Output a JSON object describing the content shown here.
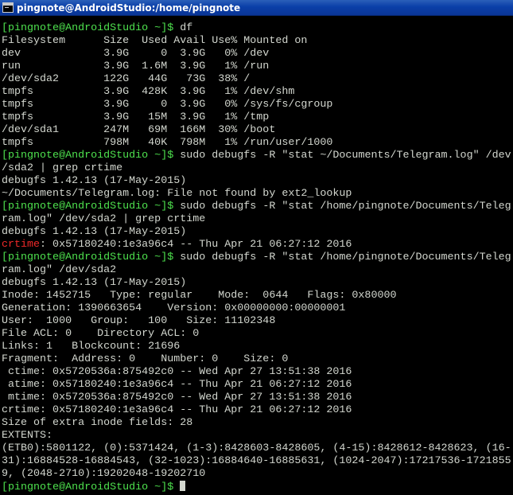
{
  "window": {
    "title": "pingnote@AndroidStudio:/home/pingnote",
    "app_icon": "terminal-icon"
  },
  "colors": {
    "titlebar": "#0a3fa8",
    "background": "#000000",
    "foreground": "#d3d7cf",
    "prompt": "#4ee24e",
    "highlight": "#ef2929"
  },
  "terminal": {
    "prompt": "[pingnote@AndroidStudio ~]$",
    "lines": [
      {
        "prompt": "[pingnote@AndroidStudio ~]$",
        "text": " df"
      },
      {
        "text": "Filesystem      Size  Used Avail Use% Mounted on"
      },
      {
        "text": "dev             3.9G     0  3.9G   0% /dev"
      },
      {
        "text": "run             3.9G  1.6M  3.9G   1% /run"
      },
      {
        "text": "/dev/sda2       122G   44G   73G  38% /"
      },
      {
        "text": "tmpfs           3.9G  428K  3.9G   1% /dev/shm"
      },
      {
        "text": "tmpfs           3.9G     0  3.9G   0% /sys/fs/cgroup"
      },
      {
        "text": "tmpfs           3.9G   15M  3.9G   1% /tmp"
      },
      {
        "text": "/dev/sda1       247M   69M  166M  30% /boot"
      },
      {
        "text": "tmpfs           798M   40K  798M   1% /run/user/1000"
      },
      {
        "prompt": "[pingnote@AndroidStudio ~]$",
        "text": " sudo debugfs -R \"stat ~/Documents/Telegram.log\" /dev"
      },
      {
        "text": "/sda2 | grep crtime"
      },
      {
        "text": "debugfs 1.42.13 (17-May-2015)"
      },
      {
        "text": "~/Documents/Telegram.log: File not found by ext2_lookup"
      },
      {
        "prompt": "[pingnote@AndroidStudio ~]$",
        "text": " sudo debugfs -R \"stat /home/pingnote/Documents/Teleg"
      },
      {
        "text": "ram.log\" /dev/sda2 | grep crtime"
      },
      {
        "text": "debugfs 1.42.13 (17-May-2015)"
      },
      {
        "red": "crtime",
        "text": ": 0x57180240:1e3a96c4 -- Thu Apr 21 06:27:12 2016"
      },
      {
        "prompt": "[pingnote@AndroidStudio ~]$",
        "text": " sudo debugfs -R \"stat /home/pingnote/Documents/Teleg"
      },
      {
        "text": "ram.log\" /dev/sda2"
      },
      {
        "text": "debugfs 1.42.13 (17-May-2015)"
      },
      {
        "text": "Inode: 1452715   Type: regular    Mode:  0644   Flags: 0x80000"
      },
      {
        "text": "Generation: 1390663654    Version: 0x00000000:00000001"
      },
      {
        "text": "User:  1000   Group:   100   Size: 11102348"
      },
      {
        "text": "File ACL: 0    Directory ACL: 0"
      },
      {
        "text": "Links: 1   Blockcount: 21696"
      },
      {
        "text": "Fragment:  Address: 0    Number: 0    Size: 0"
      },
      {
        "text": " ctime: 0x5720536a:875492c0 -- Wed Apr 27 13:51:38 2016"
      },
      {
        "text": " atime: 0x57180240:1e3a96c4 -- Thu Apr 21 06:27:12 2016"
      },
      {
        "text": " mtime: 0x5720536a:875492c0 -- Wed Apr 27 13:51:38 2016"
      },
      {
        "text": "crtime: 0x57180240:1e3a96c4 -- Thu Apr 21 06:27:12 2016"
      },
      {
        "text": "Size of extra inode fields: 28"
      },
      {
        "text": "EXTENTS:"
      },
      {
        "text": "(ETB0):5801122, (0):5371424, (1-3):8428603-8428605, (4-15):8428612-8428623, (16-"
      },
      {
        "text": "31):16884528-16884543, (32-1023):16884640-16885631, (1024-2047):17217536-1721855"
      },
      {
        "text": "9, (2048-2710):19202048-19202710"
      },
      {
        "prompt": "[pingnote@AndroidStudio ~]$",
        "text": " ",
        "cursor": true
      }
    ]
  }
}
